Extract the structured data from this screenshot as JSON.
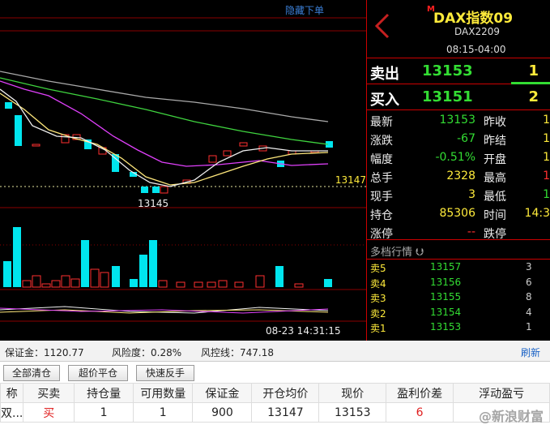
{
  "chart": {
    "hide_order_label": "隐藏下单",
    "price_marker": "13147",
    "low_marker": "13145",
    "cursor_time": "08-23 14:31:15"
  },
  "quote": {
    "badge": "M",
    "title": "DAX指数09",
    "code": "DAX2209",
    "time": "08:15-04:00",
    "sell_label": "卖出",
    "sell_price": "13153",
    "sell_vol": "1",
    "buy_label": "买入",
    "buy_price": "13151",
    "buy_vol": "2",
    "rows": [
      {
        "l1": "最新",
        "v1": "13153",
        "c1": "green",
        "l2": "昨收",
        "v2": "1"
      },
      {
        "l1": "涨跌",
        "v1": "-67",
        "c1": "green",
        "l2": "昨结",
        "v2": "1"
      },
      {
        "l1": "幅度",
        "v1": "-0.51%",
        "c1": "green",
        "l2": "开盘",
        "v2": "1"
      },
      {
        "l1": "总手",
        "v1": "2328",
        "c1": "yellow",
        "l2": "最高",
        "v2": "1"
      },
      {
        "l1": "现手",
        "v1": "3",
        "c1": "yellow",
        "l2": "最低",
        "v2": "1"
      },
      {
        "l1": "持仓",
        "v1": "85306",
        "c1": "yellow",
        "l2": "时间",
        "v2": "14:3"
      },
      {
        "l1": "涨停",
        "v1": "--",
        "c1": "red",
        "l2": "跌停",
        "v2": ""
      }
    ],
    "depth_title": "多档行情",
    "depth": [
      {
        "label": "卖5",
        "price": "13157",
        "vol": "3"
      },
      {
        "label": "卖4",
        "price": "13156",
        "vol": "6"
      },
      {
        "label": "卖3",
        "price": "13155",
        "vol": "8"
      },
      {
        "label": "卖2",
        "price": "13154",
        "vol": "4"
      },
      {
        "label": "卖1",
        "price": "13153",
        "vol": "1"
      }
    ]
  },
  "account": {
    "margin": "保证金：1120.77",
    "risk": "风险度：0.28%",
    "control": "风控线：747.18",
    "refresh": "刷新"
  },
  "buttons": {
    "clear_all": "全部清仓",
    "close_over": "超价平仓",
    "quick_reverse": "快速反手"
  },
  "table": {
    "headers": [
      "称",
      "买卖",
      "持仓量",
      "可用数量",
      "保证金",
      "开仓均价",
      "现价",
      "盈利价差",
      "浮动盈亏"
    ],
    "row": [
      "双...",
      "买",
      "1",
      "1",
      "900",
      "13147",
      "13153",
      "6",
      ""
    ]
  },
  "watermark": "@新浪财富",
  "colors": {
    "up": "#ff3030",
    "down": "#00e5ee",
    "ma_white": "#f0f0f0",
    "ma_yellow": "#ffe87c",
    "ma_magenta": "#e040fb",
    "ma_green": "#3fd43f",
    "ma_gray": "#aaaaaa"
  }
}
